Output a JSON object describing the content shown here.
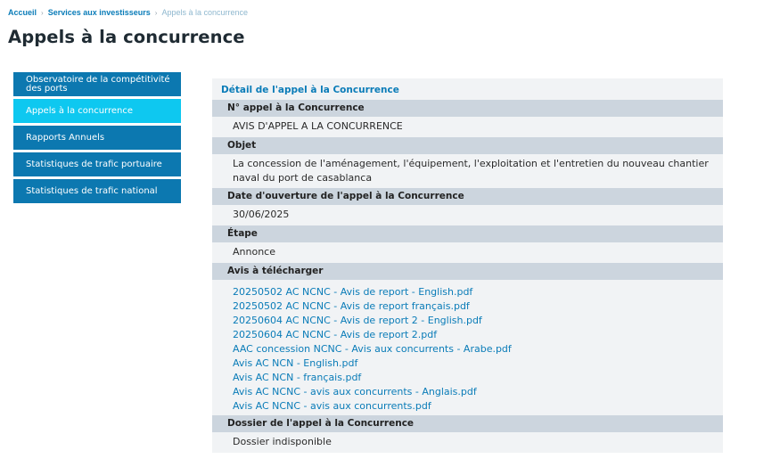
{
  "breadcrumb": {
    "home": "Accueil",
    "parent": "Services aux investisseurs",
    "current": "Appels à la concurrence",
    "separator": "›"
  },
  "page": {
    "title": "Appels à la concurrence"
  },
  "sidebar": {
    "items": [
      {
        "label": "Observatoire de la compétitivité des ports",
        "active": false
      },
      {
        "label": "Appels à la concurrence",
        "active": true
      },
      {
        "label": "Rapports Annuels",
        "active": false
      },
      {
        "label": "Statistiques de trafic portuaire",
        "active": false
      },
      {
        "label": "Statistiques de trafic national",
        "active": false
      }
    ]
  },
  "detail": {
    "title": "Détail de l'appel à la Concurrence",
    "number_label": "N° appel à la Concurrence",
    "number_value": "AVIS D'APPEL A LA CONCURRENCE",
    "objet_label": "Objet",
    "objet_value": "La concession de l'aménagement, l'équipement, l'exploitation et l'entretien du nouveau chantier naval du port de casablanca",
    "date_label": "Date d'ouverture de l'appel à la Concurrence",
    "date_value": "30/06/2025",
    "etape_label": "Étape",
    "etape_value": "Annonce",
    "avis_label": "Avis à télécharger",
    "files": [
      "20250502 AC NCNC - Avis de report - English.pdf",
      "20250502 AC NCNC - Avis de report français.pdf",
      "20250604 AC NCNC - Avis de report 2 - English.pdf",
      "20250604 AC NCNC - Avis de report 2.pdf",
      "AAC concession NCNC - Avis aux concurrents - Arabe.pdf",
      "Avis AC NCN - English.pdf",
      "Avis AC NCN - français.pdf",
      "Avis AC NCNC - avis aux concurrents - Anglais.pdf",
      "Avis AC NCNC - avis aux concurrents.pdf"
    ],
    "dossier_label": "Dossier de l'appel à la Concurrence",
    "dossier_value": "Dossier indisponible"
  },
  "colors": {
    "accent": "#0a7cb8",
    "sidebar": "#0c78b0",
    "sidebar_active": "#0ec8f0",
    "section_header": "#ccd5de",
    "panel": "#f1f3f5"
  }
}
